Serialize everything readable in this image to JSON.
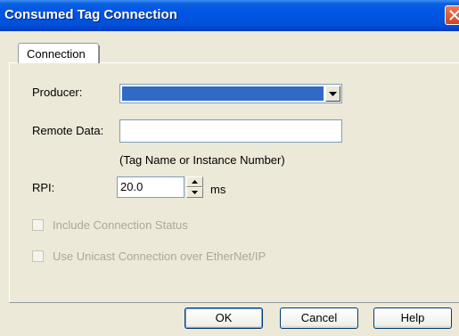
{
  "window": {
    "title": "Consumed Tag Connection"
  },
  "tabs": [
    {
      "label": "Connection"
    }
  ],
  "form": {
    "producer": {
      "label": "Producer:",
      "value": ""
    },
    "remote_data": {
      "label": "Remote Data:",
      "value": "",
      "hint": "(Tag Name or Instance Number)"
    },
    "rpi": {
      "label": "RPI:",
      "value": "20.0",
      "unit": "ms"
    },
    "include_status": {
      "label": "Include Connection Status",
      "checked": false,
      "enabled": false
    },
    "use_unicast": {
      "label": "Use Unicast Connection over EtherNet/IP",
      "checked": false,
      "enabled": false
    }
  },
  "buttons": {
    "ok": "OK",
    "cancel": "Cancel",
    "help": "Help"
  },
  "colors": {
    "titlebar": "#0055e5",
    "dialog_bg": "#ece9d8",
    "selection": "#316ac5",
    "close_button": "#d2421f"
  },
  "icons": {
    "close": "close-icon",
    "dropdown": "chevron-down-icon",
    "spin_up": "arrow-up-icon",
    "spin_down": "arrow-down-icon"
  }
}
